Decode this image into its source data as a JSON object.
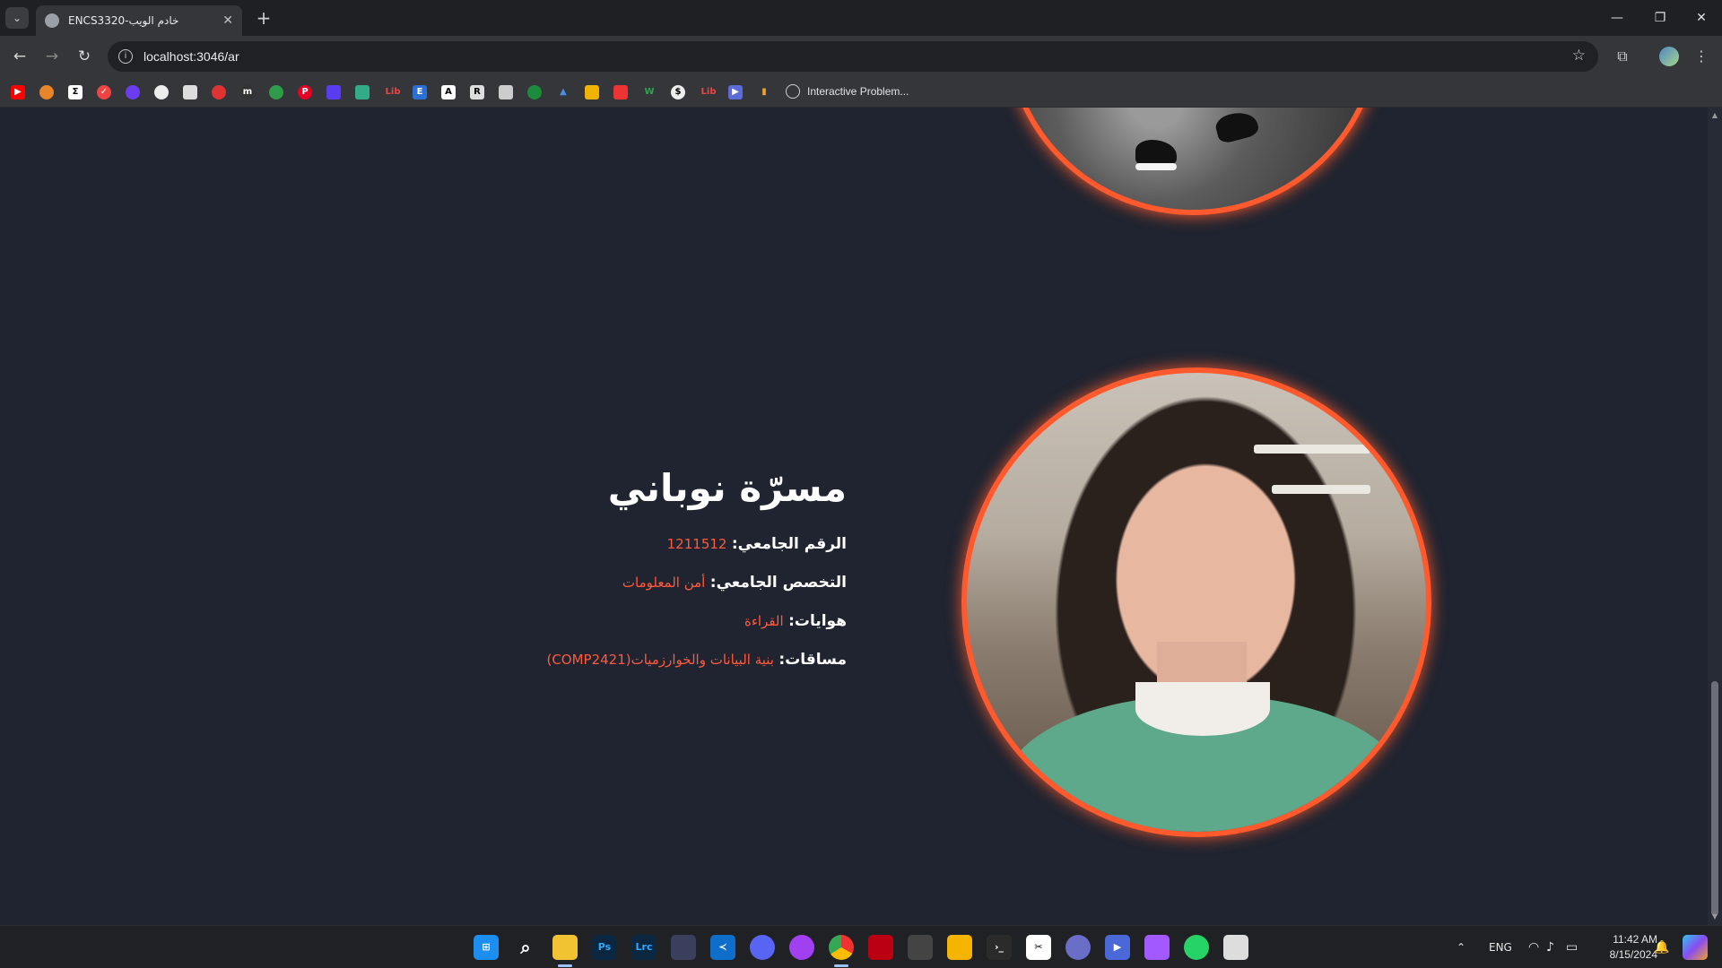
{
  "browser": {
    "tab_title": "ENCS3320-خادم الويب",
    "url": "localhost:3046/ar",
    "bookmark_label": "Interactive Problem...",
    "bookmark_letters": [
      "Lib",
      "E",
      "A",
      "R",
      "Lib"
    ]
  },
  "profile": {
    "name": "مسرّة نوباني",
    "rows": [
      {
        "label": "الرقم الجامعي:",
        "value": "1211512"
      },
      {
        "label": "التخصص الجامعي:",
        "value": "أمن المعلومات"
      },
      {
        "label": "هوايات:",
        "value": "القراءة"
      },
      {
        "label": "مساقات:",
        "value": "بنية البيانات والخوارزميات(COMP2421)"
      }
    ]
  },
  "taskbar": {
    "apps": [
      "Ps",
      "Lrc"
    ],
    "language": "ENG",
    "time": "11:42 AM",
    "date": "8/15/2024"
  },
  "colors": {
    "accent": "#ff5a2e",
    "page_bg": "#1f2430",
    "chrome_bg": "#35363a"
  }
}
